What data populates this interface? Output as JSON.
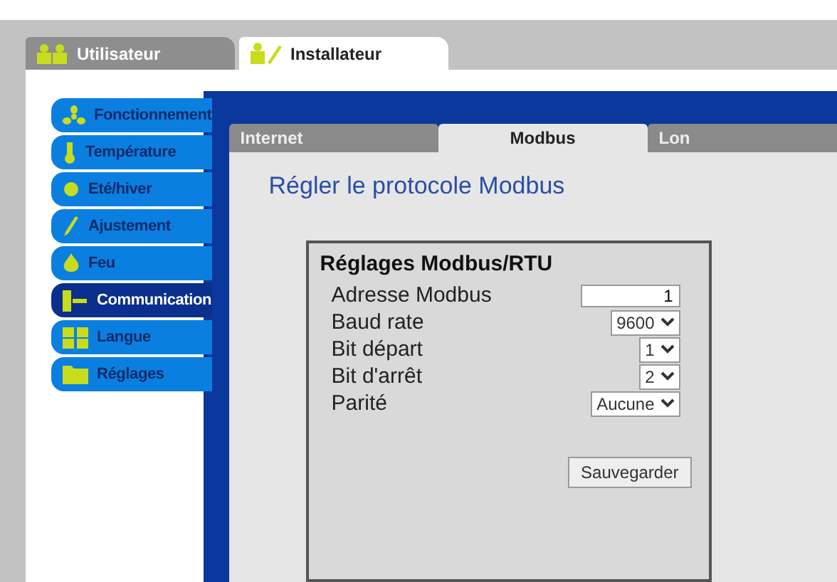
{
  "user_tabs": [
    {
      "label": "Utilisateur",
      "kind": "users",
      "selected": false
    },
    {
      "label": "Installateur",
      "kind": "installer",
      "selected": true
    }
  ],
  "sidebar": {
    "items": [
      {
        "label": "Fonctionnement",
        "kind": "fan",
        "selected": false
      },
      {
        "label": "Température",
        "kind": "thermo",
        "selected": false
      },
      {
        "label": "Eté/hiver",
        "kind": "sun",
        "selected": false
      },
      {
        "label": "Ajustement",
        "kind": "tool",
        "selected": false
      },
      {
        "label": "Feu",
        "kind": "flame",
        "selected": false
      },
      {
        "label": "Communication",
        "kind": "plug",
        "selected": true
      },
      {
        "label": "Langue",
        "kind": "grid",
        "selected": false
      },
      {
        "label": "Réglages",
        "kind": "folder",
        "selected": false
      }
    ]
  },
  "sub_tabs": [
    {
      "label": "Internet",
      "selected": false
    },
    {
      "label": "Modbus",
      "selected": true
    },
    {
      "label": "Lon",
      "selected": false
    }
  ],
  "page_title": "Régler le protocole Modbus",
  "settings": {
    "title": "Réglages Modbus/RTU",
    "fields": [
      {
        "label": "Adresse Modbus",
        "kind": "input",
        "value": "1"
      },
      {
        "label": "Baud rate",
        "kind": "select",
        "value": "9600"
      },
      {
        "label": "Bit départ",
        "kind": "select",
        "value": "1"
      },
      {
        "label": "Bit d'arrêt",
        "kind": "select",
        "value": "2"
      },
      {
        "label": "Parité",
        "kind": "select",
        "value": "Aucune"
      }
    ],
    "save_button": "Sauvegarder"
  }
}
